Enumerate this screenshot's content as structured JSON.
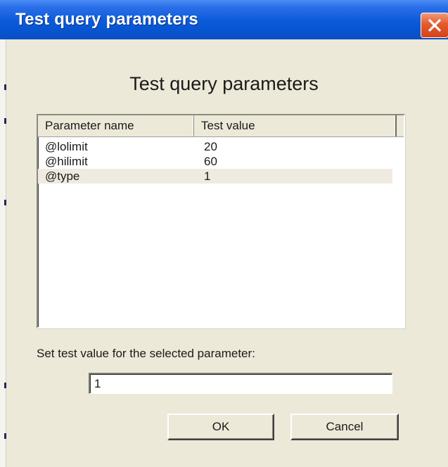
{
  "window": {
    "title": "Test query parameters",
    "close_icon": "close-x-icon",
    "titlebar_color": "#0a5ad8",
    "close_button_color": "#e55a2c"
  },
  "dialog": {
    "heading": "Test query parameters",
    "list": {
      "columns": {
        "name": "Parameter name",
        "value": "Test value"
      },
      "rows": [
        {
          "name": "@lolimit",
          "value": "20",
          "selected": false
        },
        {
          "name": "@hilimit",
          "value": "60",
          "selected": false
        },
        {
          "name": "@type",
          "value": "1",
          "selected": true
        }
      ]
    },
    "prompt": "Set test value for the selected parameter:",
    "input_value": "1",
    "buttons": {
      "ok": "OK",
      "cancel": "Cancel"
    }
  }
}
